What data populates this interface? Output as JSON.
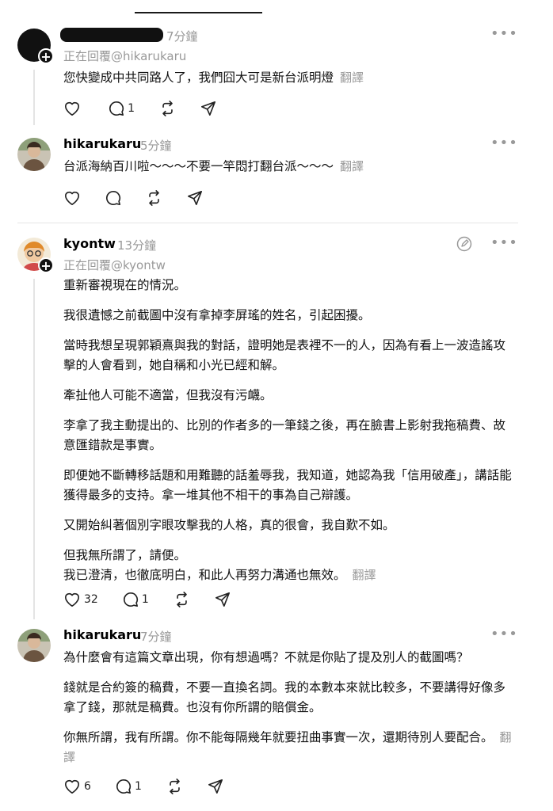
{
  "posts": [
    {
      "username": "",
      "time": "7分鐘",
      "replying_to": "正在回覆@hikarukaru",
      "paragraphs": [
        "您快變成中共同路人了，我們囧大可是新台派明燈"
      ],
      "translate": "翻譯",
      "likes": "",
      "comments": "1"
    },
    {
      "username": "hikarukaru",
      "time": "5分鐘",
      "replying_to": "",
      "paragraphs": [
        "台派海納百川啦～～～不要一竿悶打翻台派～～～"
      ],
      "translate": "翻譯",
      "likes": "",
      "comments": ""
    },
    {
      "username": "kyontw",
      "time": "13分鐘",
      "replying_to": "正在回覆@kyontw",
      "paragraphs": [
        "重新審視現在的情況。",
        "我很遺憾之前截圖中沒有拿掉李屏瑤的姓名，引起困擾。",
        "當時我想呈現郭穎熹與我的對話，證明她是表裡不一的人，因為有看上一波造謠攻擊的人會看到，她自稱和小光已經和解。",
        "牽扯他人可能不適當，但我沒有污衊。",
        "李拿了我主動提出的、比別的作者多的一筆錢之後，再在臉書上影射我拖稿費、故意匯錯款是事實。",
        "即便她不斷轉移話題和用難聽的話羞辱我，我知道，她認為我「信用破產」，講話能獲得最多的支持。拿一堆其他不相干的事為自己辯護。",
        "又開始糾著個別字眼攻擊我的人格，真的很會，我自歎不如。",
        "但我無所謂了，請便。",
        "我已澄清，也徹底明白，和此人再努力溝通也無效。"
      ],
      "translate": "翻譯",
      "likes": "32",
      "comments": "1"
    },
    {
      "username": "hikarukaru",
      "time": "7分鐘",
      "replying_to": "",
      "paragraphs": [
        "為什麼會有這篇文章出現，你有想過嗎？不就是你貼了提及別人的截圖嗎？",
        "錢就是合約簽的稿費，不要一直換名詞。我的本數本來就比較多，不要講得好像多拿了錢，那就是稿費。也沒有你所謂的賠償金。",
        "你無所謂，我有所謂。你不能每隔幾年就要扭曲事實一次，還期待別人要配合。"
      ],
      "translate": "翻譯",
      "likes": "6",
      "comments": "1"
    }
  ],
  "more_label": "•••",
  "plus_label": "+",
  "colors": {
    "muted": "#999999",
    "divider": "#e6e6e6"
  }
}
